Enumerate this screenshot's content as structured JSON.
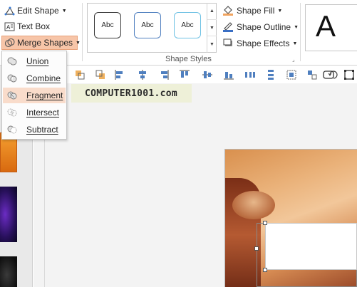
{
  "ribbon": {
    "insert_shapes": {
      "edit_shape_label": "Edit Shape",
      "text_box_label": "Text Box",
      "merge_shapes_label": "Merge Shapes"
    },
    "shape_styles": {
      "group_label": "Shape Styles",
      "swatch_text": "Abc",
      "swatch_colors": [
        "#3a3a3a",
        "#4f7fbf",
        "#6ec1e4"
      ],
      "fill_label": "Shape Fill",
      "outline_label": "Shape Outline",
      "effects_label": "Shape Effects"
    },
    "wordart": {
      "preview_letter": "A"
    }
  },
  "merge_menu": {
    "items": [
      {
        "label": "Union",
        "icon": "union-icon",
        "highlighted": false
      },
      {
        "label": "Combine",
        "icon": "combine-icon",
        "highlighted": false
      },
      {
        "label": "Fragment",
        "icon": "fragment-icon",
        "highlighted": true
      },
      {
        "label": "Intersect",
        "icon": "intersect-icon",
        "highlighted": false
      },
      {
        "label": "Subtract",
        "icon": "subtract-icon",
        "highlighted": false
      }
    ]
  },
  "watermark": {
    "text": "COMPUTER1001.com"
  },
  "colors": {
    "accent_highlight": "#f7c5a8",
    "menu_highlight": "#f9dccb",
    "watermark_bg": "#eef0d8"
  },
  "toolbar_icons": [
    "bring-forward-icon",
    "send-backward-icon",
    "align-left-icon",
    "align-center-icon",
    "align-right-icon",
    "align-top-icon",
    "align-middle-icon",
    "align-bottom-icon",
    "distribute-horizontal-icon",
    "distribute-vertical-icon",
    "group-icon",
    "ungroup-icon",
    "rotate-icon",
    "rectangle-icon",
    "selection-pane-icon"
  ]
}
